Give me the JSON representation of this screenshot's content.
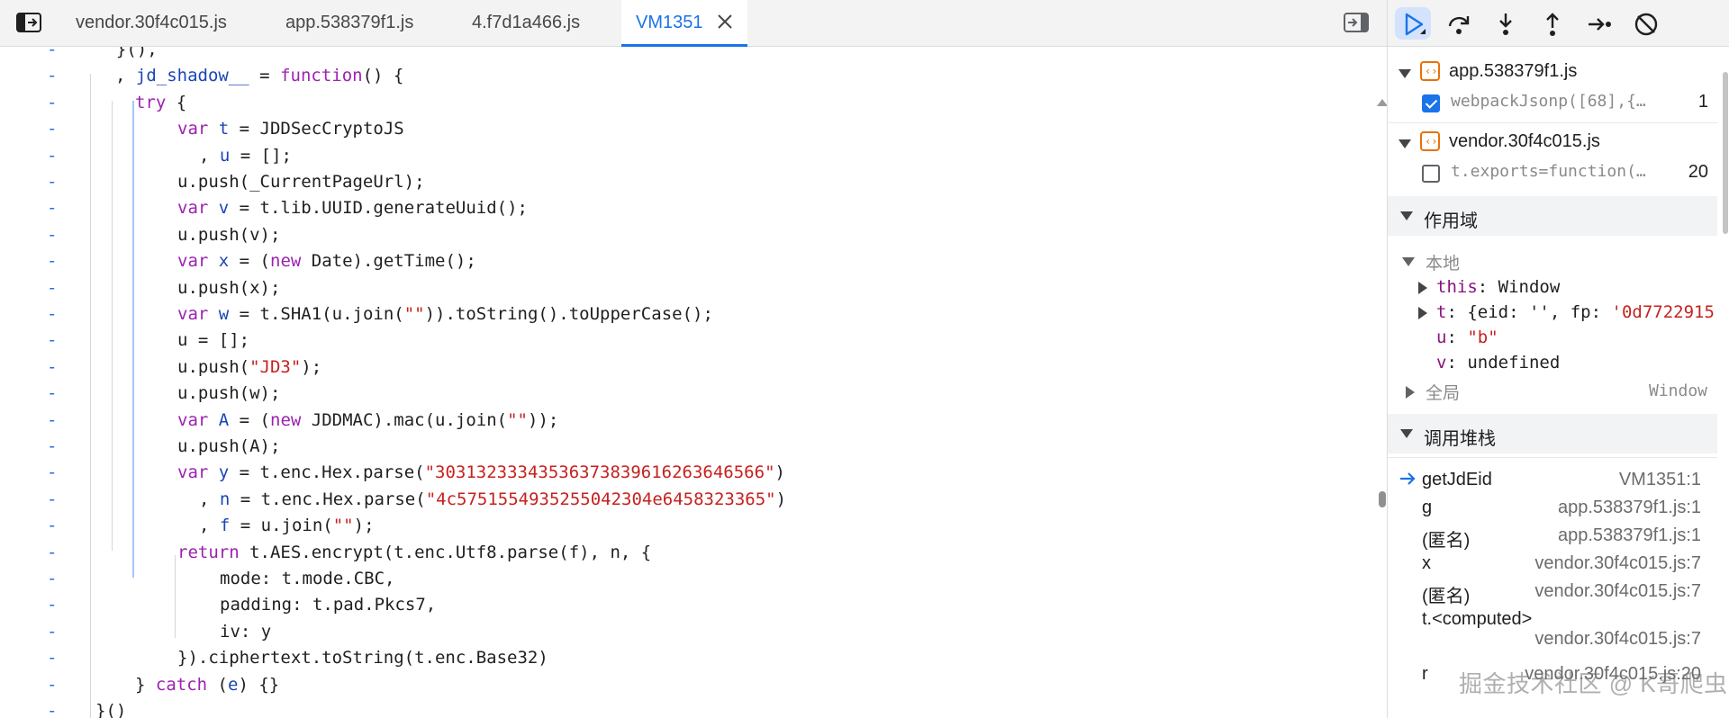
{
  "tabs": [
    {
      "label": "vendor.30f4c015.js"
    },
    {
      "label": "app.538379f1.js"
    },
    {
      "label": "4.f7d1a466.js"
    },
    {
      "label": "VM1351"
    }
  ],
  "code": {
    "gutter_marker": "-",
    "lines": [
      {
        "id": "l0",
        "text": "  }(),"
      },
      {
        "id": "l1",
        "text": ", jd_shadow__ = function() {"
      },
      {
        "id": "l2",
        "text": "try {"
      },
      {
        "id": "l3",
        "text": "var t = JDDSecCryptoJS"
      },
      {
        "id": "l4",
        "text": ", u = [];"
      },
      {
        "id": "l5",
        "text": "u.push(_CurrentPageUrl);"
      },
      {
        "id": "l6",
        "text": "var v = t.lib.UUID.generateUuid();"
      },
      {
        "id": "l7",
        "text": "u.push(v);"
      },
      {
        "id": "l8",
        "text": "var x = (new Date).getTime();"
      },
      {
        "id": "l9",
        "text": "u.push(x);"
      },
      {
        "id": "l10",
        "text": "var w = t.SHA1(u.join(\"\")).toString().toUpperCase();"
      },
      {
        "id": "l11",
        "text": "u = [];"
      },
      {
        "id": "l12",
        "text": "u.push(\"JD3\");"
      },
      {
        "id": "l13",
        "text": "u.push(w);"
      },
      {
        "id": "l14",
        "text": "var A = (new JDDMAC).mac(u.join(\"\"));"
      },
      {
        "id": "l15",
        "text": "u.push(A);"
      },
      {
        "id": "l16",
        "text": "var y = t.enc.Hex.parse(\"30313233343536373839616263646566\")"
      },
      {
        "id": "l17",
        "text": ", n = t.enc.Hex.parse(\"4c5751554935255042304e6458323365\")"
      },
      {
        "id": "l18",
        "text": ", f = u.join(\"\");"
      },
      {
        "id": "l19",
        "text": "return t.AES.encrypt(t.enc.Utf8.parse(f), n, {"
      },
      {
        "id": "l20",
        "text": "mode: t.mode.CBC,"
      },
      {
        "id": "l21",
        "text": "padding: t.pad.Pkcs7,"
      },
      {
        "id": "l22",
        "text": "iv: y"
      },
      {
        "id": "l23",
        "text": "}).ciphertext.toString(t.enc.Base32)"
      },
      {
        "id": "l24",
        "text": "} catch (e) {}"
      },
      {
        "id": "l25",
        "text": "}()"
      }
    ]
  },
  "breakpoints": [
    {
      "file": "app.538379f1.js",
      "code": "webpackJsonp([68],{…",
      "line": "1",
      "checked": true
    },
    {
      "file": "vendor.30f4c015.js",
      "code": "t.exports=function(…",
      "line": "20",
      "checked": false
    }
  ],
  "scope": {
    "title": "作用域",
    "local_label": "本地",
    "this_key": "this",
    "this_val": "Window",
    "t_key": "t",
    "t_val_prefix": "{eid: '', fp: ",
    "t_val_str": "'0d7722915",
    "u_key": "u",
    "u_val": "\"b\"",
    "v_key": "v",
    "v_val": "undefined",
    "global_label": "全局",
    "global_val": "Window"
  },
  "callstack": {
    "title": "调用堆栈",
    "frames": [
      {
        "fn": "getJdEid",
        "loc": "VM1351:1",
        "current": true
      },
      {
        "fn": "g",
        "loc": "app.538379f1.js:1"
      },
      {
        "fn": "(匿名)",
        "loc": "app.538379f1.js:1"
      },
      {
        "fn": "x",
        "loc": "vendor.30f4c015.js:7"
      },
      {
        "fn": "(匿名)",
        "loc": "vendor.30f4c015.js:7"
      },
      {
        "fn": "t.<computed>",
        "loc": "vendor.30f4c015.js:7"
      },
      {
        "fn": "r",
        "loc": "vendor.30f4c015.js:20"
      }
    ]
  },
  "watermark": "掘金技术社区 @ K哥爬虫",
  "colors": {
    "accent": "#1a73e8",
    "keyword": "#9c22b1",
    "string": "#c5221f",
    "identifier": "#1a45b8"
  }
}
